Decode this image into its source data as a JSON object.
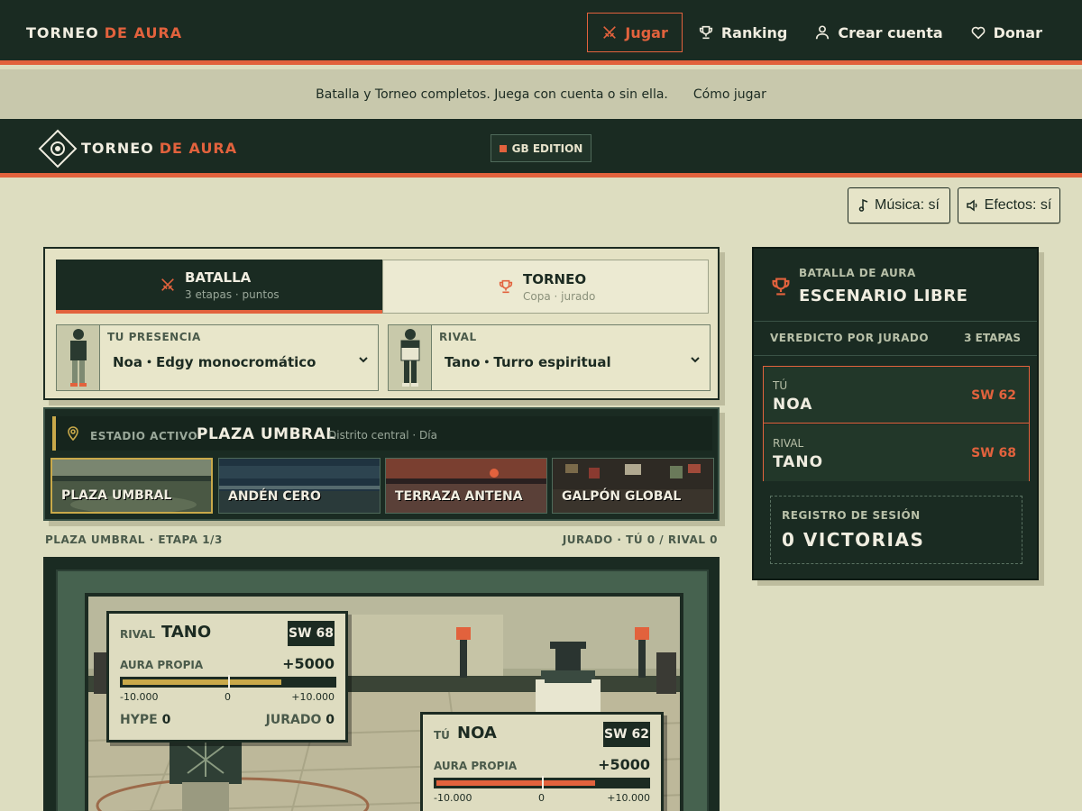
{
  "nav": {
    "brand_a": "TORNEO",
    "brand_b": "DE AURA",
    "links": [
      "Jugar",
      "Ranking",
      "Crear cuenta",
      "Donar"
    ]
  },
  "banner": {
    "text": "Batalla y Torneo completos. Juega con cuenta o sin ella.",
    "link": "Cómo jugar"
  },
  "game": {
    "title_a": "TORNEO",
    "title_b": "DE AURA",
    "edition": "GB EDITION",
    "music": "Música: sí",
    "effects": "Efectos: sí"
  },
  "modes": [
    {
      "label": "BATALLA",
      "sub": "3 etapas · puntos"
    },
    {
      "label": "TORNEO",
      "sub": "Copa · jurado"
    }
  ],
  "selectors": {
    "you_caption": "TU PRESENCIA",
    "you_value": "Noa・Edgy monocromático",
    "rival_caption": "RIVAL",
    "rival_value": "Tano・Turro espiritual"
  },
  "stadium": {
    "caption": "ESTADIO ACTIVO",
    "name": "PLAZA UMBRAL",
    "desc": "Distrito central · Día",
    "options": [
      "PLAZA UMBRAL",
      "ANDÉN CERO",
      "TERRAZA ANTENA",
      "GALPÓN GLOBAL"
    ]
  },
  "status": {
    "left": "PLAZA UMBRAL · ETAPA 1/3",
    "right": "JURADO · TÚ 0 / RIVAL 0"
  },
  "hud_rival": {
    "who": "RIVAL",
    "name": "TANO",
    "sw": "SW 68",
    "aura_label": "AURA PROPIA",
    "aura_value": "+5000",
    "aura_fraction": 0.75,
    "min": "-10.000",
    "zero": "0",
    "max": "+10.000",
    "hype_label": "HYPE",
    "hype": "0",
    "jurado_label": "JURADO",
    "jurado": "0"
  },
  "hud_you": {
    "who": "TÚ",
    "name": "NOA",
    "sw": "SW 62",
    "aura_label": "AURA PROPIA",
    "aura_value": "+5000",
    "aura_fraction": 0.75,
    "min": "-10.000",
    "zero": "0",
    "max": "+10.000"
  },
  "side": {
    "caption": "BATALLA DE AURA",
    "title": "ESCENARIO LIBRE",
    "verdict": "VEREDICTO POR JURADO",
    "stages": "3 ETAPAS",
    "players": [
      {
        "role": "TÚ",
        "name": "NOA",
        "sw": "SW 62"
      },
      {
        "role": "RIVAL",
        "name": "TANO",
        "sw": "SW 68"
      }
    ],
    "log_caption": "REGISTRO DE SESIÓN",
    "log_value": "0 VICTORIAS"
  },
  "colors": {
    "accent": "#e2623d",
    "dark": "#1a2b22",
    "gold": "#c9a94a",
    "paper": "#ddddc0"
  }
}
